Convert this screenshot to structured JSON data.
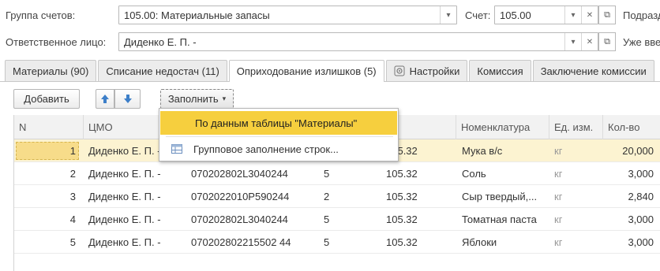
{
  "header": {
    "group_label": "Группа счетов:",
    "group_value": "105.00: Материальные запасы",
    "account_label": "Счет:",
    "account_value": "105.00",
    "subdivision_label": "Подразд",
    "responsible_label": "Ответственное лицо:",
    "responsible_value": "Диденко Е. П. -",
    "already_label": "Уже вве"
  },
  "tabs": [
    {
      "label": "Материалы (90)"
    },
    {
      "label": "Списание недостач (11)"
    },
    {
      "label": "Оприходование излишков (5)",
      "active": true
    },
    {
      "label": "Настройки",
      "icon": "gear-icon"
    },
    {
      "label": "Комиссия"
    },
    {
      "label": "Заключение комиссии"
    }
  ],
  "toolbar": {
    "add_label": "Добавить",
    "fill_label": "Заполнить"
  },
  "fill_menu": {
    "items": [
      {
        "label": "По данным таблицы \"Материалы\""
      },
      {
        "label": "Групповое заполнение строк..."
      }
    ]
  },
  "table": {
    "columns": [
      "N",
      "ЦМО",
      "",
      "",
      "ет",
      "Номенклатура",
      "Ед. изм.",
      "Кол-во"
    ],
    "rows": [
      {
        "n": "1",
        "cmo": "Диденко Е. П. -",
        "code": "",
        "kps": "",
        "account": "105.32",
        "item": "Мука в/с",
        "unit": "кг",
        "qty": "20,000"
      },
      {
        "n": "2",
        "cmo": "Диденко Е. П. -",
        "code": "070202802L3040244",
        "kps": "5",
        "account": "105.32",
        "item": "Соль",
        "unit": "кг",
        "qty": "3,000"
      },
      {
        "n": "3",
        "cmo": "Диденко Е. П. -",
        "code": "0702022010P590244",
        "kps": "2",
        "account": "105.32",
        "item": "Сыр твердый,...",
        "unit": "кг",
        "qty": "2,840"
      },
      {
        "n": "4",
        "cmo": "Диденко Е. П. -",
        "code": "070202802L3040244",
        "kps": "5",
        "account": "105.32",
        "item": "Томатная паста",
        "unit": "кг",
        "qty": "3,000"
      },
      {
        "n": "5",
        "cmo": "Диденко Е. П. -",
        "code": "070202802215502 44",
        "kps": "5",
        "account": "105.32",
        "item": "Яблоки",
        "unit": "кг",
        "qty": "3,000"
      }
    ]
  },
  "colors": {
    "selected_row": "#fcf3d1",
    "menu_highlight": "#f6cf3e",
    "arrow_blue": "#3d7fc9"
  }
}
